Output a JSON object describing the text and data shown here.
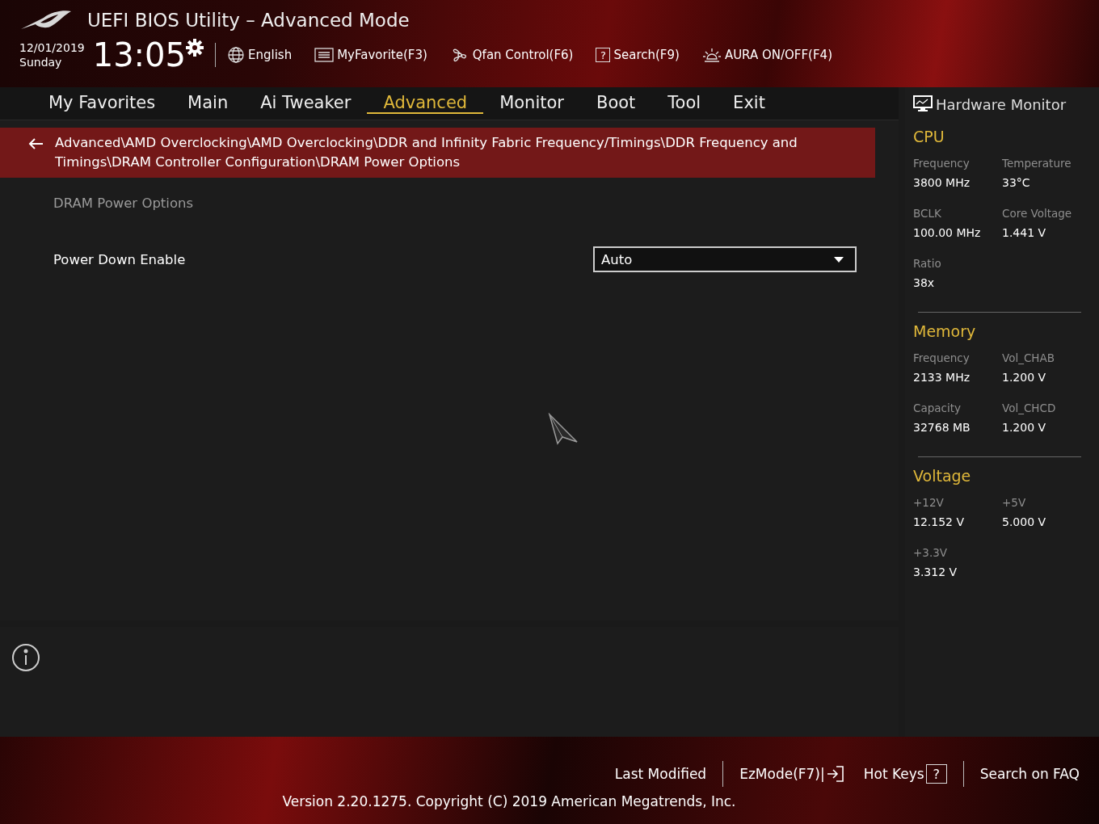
{
  "window": {
    "title": "UEFI BIOS Utility – Advanced Mode"
  },
  "header": {
    "date": "12/01/2019",
    "day": "Sunday",
    "time": "13:05",
    "tools": [
      {
        "kind": "globe",
        "label": "English"
      },
      {
        "kind": "favorite",
        "label": "MyFavorite(F3)"
      },
      {
        "kind": "fan",
        "label": "Qfan Control(F6)"
      },
      {
        "kind": "search",
        "key": "?",
        "label": "Search(F9)"
      },
      {
        "kind": "aura",
        "label": "AURA ON/OFF(F4)"
      }
    ]
  },
  "tabs": [
    {
      "label": "My Favorites",
      "selected": false
    },
    {
      "label": "Main",
      "selected": false
    },
    {
      "label": "Ai Tweaker",
      "selected": false
    },
    {
      "label": "Advanced",
      "selected": true
    },
    {
      "label": "Monitor",
      "selected": false
    },
    {
      "label": "Boot",
      "selected": false
    },
    {
      "label": "Tool",
      "selected": false
    },
    {
      "label": "Exit",
      "selected": false
    }
  ],
  "breadcrumb": "Advanced\\AMD Overclocking\\AMD Overclocking\\DDR and Infinity Fabric Frequency/Timings\\DDR Frequency and Timings\\DRAM Controller Configuration\\DRAM Power Options",
  "section_title": "DRAM Power Options",
  "settings": [
    {
      "label": "Power Down Enable",
      "value": "Auto"
    }
  ],
  "hardware_monitor": {
    "title": "Hardware Monitor",
    "groups": [
      {
        "title": "CPU",
        "items": [
          {
            "label": "Frequency",
            "value": "3800 MHz"
          },
          {
            "label": "Temperature",
            "value": "33°C"
          },
          {
            "label": "BCLK",
            "value": "100.00 MHz"
          },
          {
            "label": "Core Voltage",
            "value": "1.441 V"
          },
          {
            "label": "Ratio",
            "value": "38x"
          }
        ]
      },
      {
        "title": "Memory",
        "items": [
          {
            "label": "Frequency",
            "value": "2133 MHz"
          },
          {
            "label": "Vol_CHAB",
            "value": "1.200 V"
          },
          {
            "label": "Capacity",
            "value": "32768 MB"
          },
          {
            "label": "Vol_CHCD",
            "value": "1.200 V"
          }
        ]
      },
      {
        "title": "Voltage",
        "items": [
          {
            "label": "+12V",
            "value": "12.152 V"
          },
          {
            "label": "+5V",
            "value": "5.000 V"
          },
          {
            "label": "+3.3V",
            "value": "3.312 V"
          }
        ]
      }
    ]
  },
  "footer": {
    "buttons": [
      {
        "kind": "plain",
        "label": "Last Modified"
      },
      {
        "kind": "exit",
        "label": "EzMode(F7)|"
      },
      {
        "kind": "key",
        "label": "Hot Keys",
        "key": "?"
      },
      {
        "kind": "plain",
        "label": "Search on FAQ"
      }
    ],
    "version": "Version 2.20.1275. Copyright (C) 2019 American Megatrends, Inc."
  }
}
